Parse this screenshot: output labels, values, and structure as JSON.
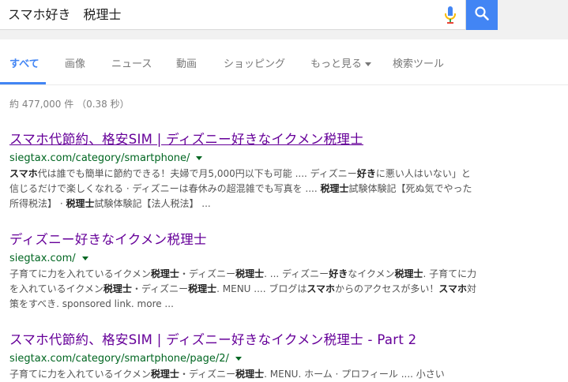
{
  "search": {
    "query": "スマホ好き　税理士"
  },
  "icons": {
    "mic": "microphone-icon",
    "search": "search-icon",
    "dropdown": "triangle-down-icon"
  },
  "colors": {
    "accent": "#4285f4",
    "title_visited": "#660099",
    "url": "#006621"
  },
  "tabs": [
    {
      "label": "すべて",
      "active": true
    },
    {
      "label": "画像"
    },
    {
      "label": "ニュース"
    },
    {
      "label": "動画"
    },
    {
      "label": "ショッピング"
    },
    {
      "label": "もっと見る"
    },
    {
      "label": "検索ツール"
    }
  ],
  "stats": "約 477,000 件 （0.38 秒）",
  "results": [
    {
      "title": "スマホ代節約、格安SIM | ディズニー好きなイクメン税理士",
      "url": "siegtax.com/category/smartphone/",
      "snippet": [
        {
          "t": "スマホ",
          "b": true
        },
        {
          "t": "代は誰でも簡単に節約できる！夫婦で月5,000円以下も可能 .... ディズニー"
        },
        {
          "t": "好き",
          "b": true
        },
        {
          "t": "に悪い人はいない」と信じるだけで楽しくなれる · ディズニーは春休みの超混雑でも写真を .... "
        },
        {
          "t": "税理士",
          "b": true
        },
        {
          "t": "試験体験記【死ぬ気でやった所得税法】 · "
        },
        {
          "t": "税理士",
          "b": true
        },
        {
          "t": "試験体験記【法人税法】 ..."
        }
      ]
    },
    {
      "title": "ディズニー好きなイクメン税理士",
      "url": "siegtax.com/",
      "snippet": [
        {
          "t": "子育てに力を入れているイクメン"
        },
        {
          "t": "税理士",
          "b": true
        },
        {
          "t": "・ディズニー"
        },
        {
          "t": "税理士",
          "b": true
        },
        {
          "t": ". ... ディズニー"
        },
        {
          "t": "好き",
          "b": true
        },
        {
          "t": "なイクメン"
        },
        {
          "t": "税理士",
          "b": true
        },
        {
          "t": ". 子育てに力を入れているイクメン"
        },
        {
          "t": "税理士",
          "b": true
        },
        {
          "t": "・ディズニー"
        },
        {
          "t": "税理士",
          "b": true
        },
        {
          "t": ". MENU .... ブログは"
        },
        {
          "t": "スマホ",
          "b": true
        },
        {
          "t": "からのアクセスが多い！"
        },
        {
          "t": "スマホ",
          "b": true
        },
        {
          "t": "対策をすべき. sponsored link. more ..."
        }
      ]
    },
    {
      "title": "スマホ代節約、格安SIM | ディズニー好きなイクメン税理士 - Part 2",
      "url": "siegtax.com/category/smartphone/page/2/",
      "snippet": [
        {
          "t": "子育てに力を入れているイクメン"
        },
        {
          "t": "税理士",
          "b": true
        },
        {
          "t": "・ディズニー"
        },
        {
          "t": "税理士",
          "b": true
        },
        {
          "t": ". MENU. ホーム · プロフィール .... 小さい"
        }
      ]
    }
  ]
}
